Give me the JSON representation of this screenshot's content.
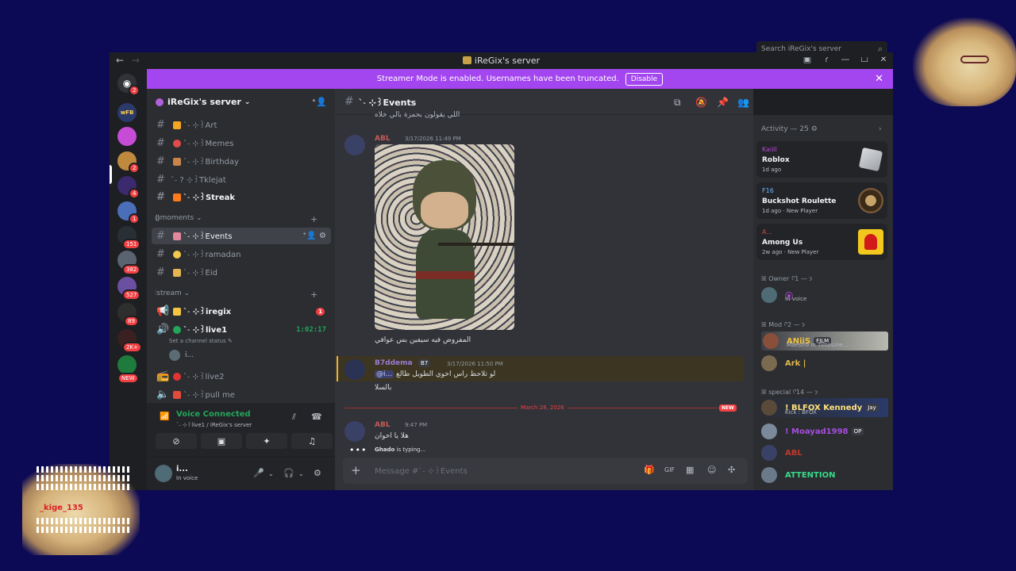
{
  "window": {
    "title": "iReGix's server",
    "nav_back": "←",
    "nav_forward": "→",
    "controls": [
      "▣",
      "?",
      "—",
      "☐",
      "✕"
    ]
  },
  "banner": {
    "text": "Streamer Mode is enabled. Usernames have been truncated.",
    "button": "Disable",
    "close": "✕"
  },
  "server_list": {
    "badges": [
      "2",
      "2",
      "4",
      "1",
      "151",
      "382",
      "527",
      "89",
      "2K+"
    ],
    "new_label": "NEW",
    "wfb": "wFB"
  },
  "sidebar": {
    "server_name": "iReGix's server",
    "channels_top": [
      {
        "name": "ˋ˗ ⊹꒱Art"
      },
      {
        "name": "ˋ˗ ⊹꒱Memes"
      },
      {
        "name": "ˋ˗ ⊹꒱Birthday"
      },
      {
        "name": "ˋ˗ ? ⊹꒱Tklejat"
      },
      {
        "name": "ˋ˗ ⊹꒱Streak"
      }
    ],
    "category_moments": "⟬⟭moments",
    "channels_moments": [
      {
        "name": "ˋ˗ ⊹꒱Events"
      },
      {
        "name": "ˋ˗ ⊹꒱ramadan"
      },
      {
        "name": "ˋ˗ ⊹꒱Eid"
      }
    ],
    "category_stream": "⫶stream",
    "voice_channels": [
      {
        "name": "ˋ˗ ⊹꒱iregix",
        "badge": "1"
      },
      {
        "name": "ˋ˗ ⊹꒱live1",
        "timer": "1:02:17"
      },
      {
        "name": "ˋ˗ ⊹꒱live2"
      },
      {
        "name": "ˋ˗ ⊹꒱pull me"
      }
    ],
    "channel_status": "Set a channel status ✎",
    "voice_user": "i..."
  },
  "voice_panel": {
    "status": "Voice Connected",
    "sub": "ˋ˗ ⊹꒱live1 / iReGix's server"
  },
  "user_panel": {
    "name": "i...",
    "status": "In voice"
  },
  "chat": {
    "channel": "ˋ˗ ⊹꒱Events",
    "top_cut_text": "اللي يقولون بحمزة بالي خلاه",
    "messages": [
      {
        "author": "ABL",
        "time": "3/17/2026 11:49 PM",
        "text": "المفروض فيه سيفين بس عوافي"
      },
      {
        "author": "B7ddema",
        "tag": "B7",
        "time": "3/17/2026 11:50 PM",
        "mention": "@i...",
        "text": "لو تلاحظ راس اخوي الطويل طالع",
        "text2": "بالسلا"
      },
      {
        "author": "ABL",
        "time": "9:47 PM",
        "text": "هلا يا اخوان"
      }
    ],
    "divider": "March 28, 2026",
    "new_tag": "NEW",
    "typing_user": "Ghado",
    "typing_suffix": " is typing...",
    "composer_placeholder": "Message #ˋ˗ ⊹꒱Events"
  },
  "search": {
    "placeholder": "Search iReGix's server"
  },
  "activity": {
    "header": "Activity — 25",
    "cards": [
      {
        "user": "Kaiiil",
        "game": "Roblox",
        "meta": "1d ago"
      },
      {
        "user": "F16",
        "game": "Buckshot Roulette",
        "meta": "1d ago · New Player"
      },
      {
        "user": "A...",
        "game": "Among Us",
        "meta": "2w ago · New Player"
      }
    ]
  },
  "members": {
    "owner_header": "ꕤ Owner ᢉ𐭩 — 1",
    "owner": {
      "name": "",
      "sub": "In voice"
    },
    "mod_header": "ꕤ Mod ᢉ𐭩 — 2",
    "mods": [
      {
        "name": "ANiiS",
        "tag": "FILM",
        "sub": "Maestro In TimeLine..."
      },
      {
        "name": "Ark |",
        "sub": ""
      }
    ],
    "special_header": "ꕤ special ᢉ𐭩 — 14",
    "special": [
      {
        "name": "! BLFOX Kennedy",
        "tag": "Jay",
        "sub": "Kick : BFOX"
      },
      {
        "name": "! Moayad1998",
        "tag": "OP"
      },
      {
        "name": "ABL"
      },
      {
        "name": "ATTENTION"
      }
    ]
  },
  "colors": {
    "accent": "#a346f0",
    "voice_green": "#23a55a",
    "danger": "#f23f42"
  },
  "overlay": {
    "stamp": "_kige_135"
  }
}
